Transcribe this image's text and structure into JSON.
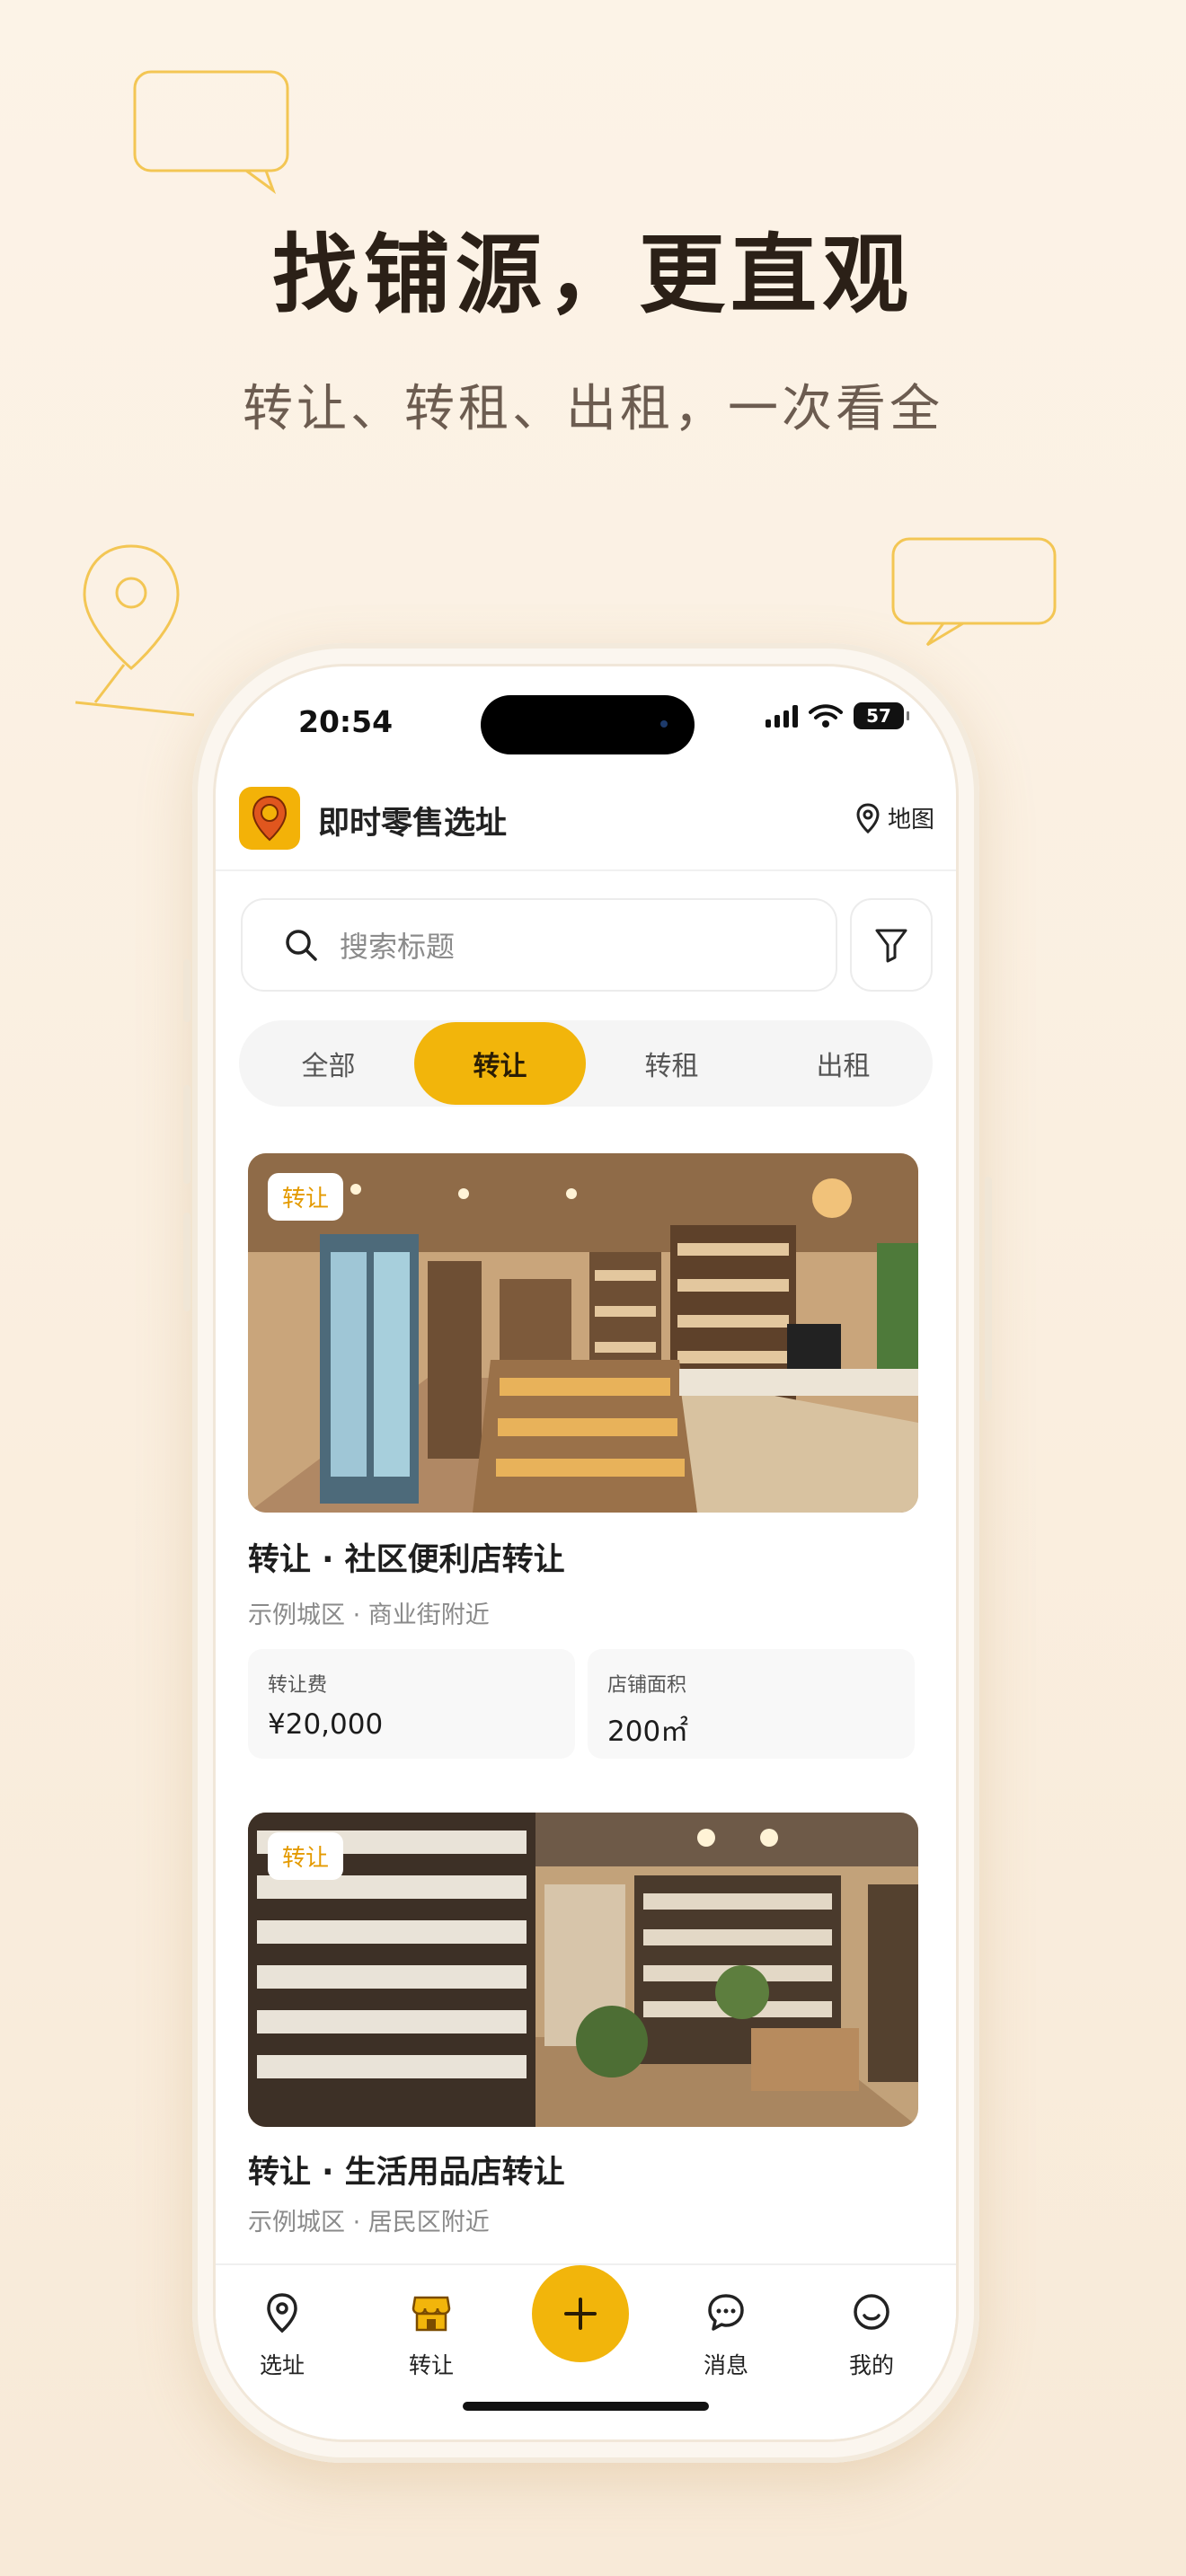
{
  "hero": {
    "title": "找铺源，更直观",
    "subtitle": "转让、转租、出租，一次看全"
  },
  "status_bar": {
    "time": "20:54",
    "battery": "57"
  },
  "app_header": {
    "title": "即时零售选址",
    "map_label": "地图"
  },
  "search": {
    "placeholder": "搜索标题"
  },
  "filter_tabs": [
    {
      "label": "全部",
      "active": false
    },
    {
      "label": "转让",
      "active": true
    },
    {
      "label": "转租",
      "active": false
    },
    {
      "label": "出租",
      "active": false
    }
  ],
  "listings": [
    {
      "badge": "转让",
      "title": "转让 · 社区便利店转让",
      "location": "示例城区 · 商业街附近",
      "stats": [
        {
          "label": "转让费",
          "value": "¥20,000"
        },
        {
          "label": "店铺面积",
          "value": "200㎡"
        }
      ]
    },
    {
      "badge": "转让",
      "title": "转让 · 生活用品店转让",
      "location": "示例城区 · 居民区附近"
    }
  ],
  "tabbar": {
    "items": [
      {
        "label": "选址",
        "icon": "location-pin-icon"
      },
      {
        "label": "转让",
        "icon": "shop-icon"
      },
      {
        "label": "消息",
        "icon": "chat-bubble-icon"
      },
      {
        "label": "我的",
        "icon": "smile-face-icon"
      }
    ],
    "fab_icon": "plus-icon"
  },
  "colors": {
    "accent": "#f2b50b",
    "background": "#fcf3e7",
    "badge_text": "#e49a00"
  }
}
